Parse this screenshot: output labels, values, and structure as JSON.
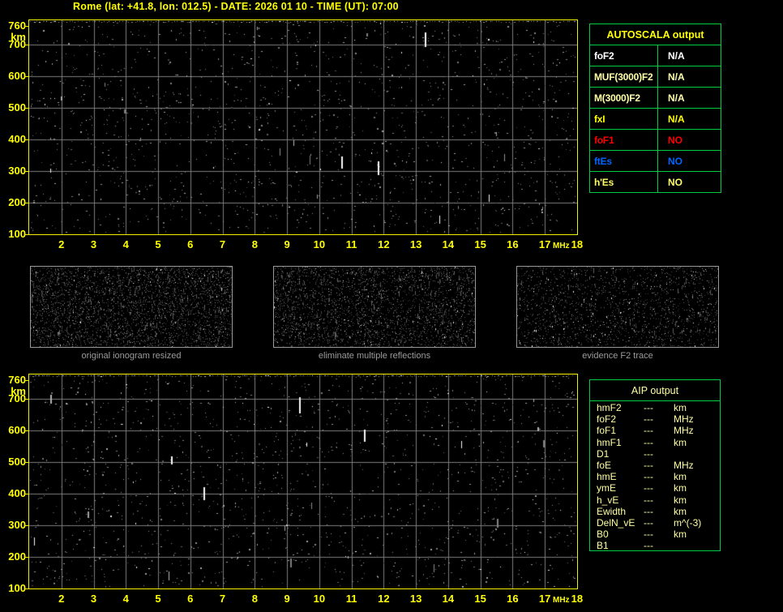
{
  "window": {
    "title": "Rome (lat: +41.8, lon: 012.5) - DATE: 2026 01 10 - TIME (UT): 07:00"
  },
  "colors": {
    "accent_yellow": "#ffff00",
    "pale_yellow": "#ffffa0",
    "table_green": "#00cc44",
    "status_red": "#ff0000",
    "status_blue": "#0066ff",
    "white": "#ffffff",
    "caption_gray": "#9c9c9c",
    "grid_gray": "#7d7d7d",
    "thumb_border_gray": "#989898"
  },
  "ionogram_axes": {
    "y_unit": "km",
    "y_ticks": [
      "760",
      "700",
      "600",
      "500",
      "400",
      "300",
      "200",
      "100"
    ],
    "x_unit": "MHz",
    "x_ticks": [
      "2",
      "3",
      "4",
      "5",
      "6",
      "7",
      "8",
      "9",
      "10",
      "11",
      "12",
      "13",
      "14",
      "15",
      "16",
      "17",
      "18"
    ]
  },
  "thumbnails": [
    {
      "caption": "original ionogram resized"
    },
    {
      "caption": "eliminate multiple reflections"
    },
    {
      "caption": "evidence F2 trace"
    }
  ],
  "autoscala": {
    "title": "AUTOSCALA output",
    "rows": [
      {
        "param": "foF2",
        "value": "N/A",
        "color": "#ffffff"
      },
      {
        "param": "MUF(3000)F2",
        "value": "N/A",
        "color": "#ffffa8"
      },
      {
        "param": "M(3000)F2",
        "value": "N/A",
        "color": "#ffffa8"
      },
      {
        "param": "fxI",
        "value": "N/A",
        "color": "#ffff00"
      },
      {
        "param": "foF1",
        "value": "NO",
        "color": "#ff0000"
      },
      {
        "param": "ftEs",
        "value": "NO",
        "color": "#0066ff"
      },
      {
        "param": "h'Es",
        "value": "NO",
        "color": "#ffff66"
      }
    ]
  },
  "aip": {
    "title": "AIP output",
    "rows": [
      {
        "param": "hmF2",
        "value": "---",
        "unit": "km"
      },
      {
        "param": "foF2",
        "value": "---",
        "unit": "MHz"
      },
      {
        "param": "foF1",
        "value": "---",
        "unit": "MHz"
      },
      {
        "param": "hmF1",
        "value": "---",
        "unit": "km"
      },
      {
        "param": "D1",
        "value": "---",
        "unit": ""
      },
      {
        "param": "foE",
        "value": "---",
        "unit": "MHz"
      },
      {
        "param": "hmE",
        "value": "---",
        "unit": "km"
      },
      {
        "param": "ymE",
        "value": "---",
        "unit": "km"
      },
      {
        "param": "h_vE",
        "value": "---",
        "unit": "km"
      },
      {
        "param": "Ewidth",
        "value": "---",
        "unit": "km"
      },
      {
        "param": "DelN_vE",
        "value": "---",
        "unit": "m^(-3)"
      },
      {
        "param": "B0",
        "value": "---",
        "unit": "km"
      },
      {
        "param": "B1",
        "value": "---",
        "unit": ""
      }
    ]
  }
}
